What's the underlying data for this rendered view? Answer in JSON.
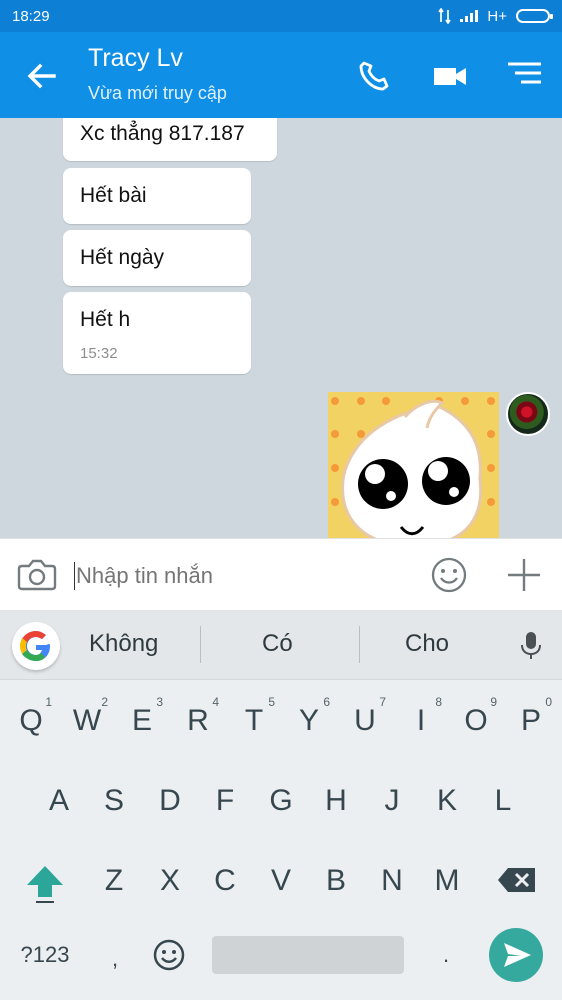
{
  "status_bar": {
    "time": "18:29",
    "network": "H+"
  },
  "chat_header": {
    "contact_name": "Tracy Lv",
    "contact_status": "Vừa mới truy cập"
  },
  "messages": [
    {
      "text": "Xc thẳng 817.187"
    },
    {
      "text": "Hết bài"
    },
    {
      "text": "Hết ngày"
    },
    {
      "text": "Hết h",
      "time": "15:32"
    }
  ],
  "composer": {
    "placeholder": "Nhập tin nhắn"
  },
  "keyboard": {
    "suggestions": [
      "Không",
      "Có",
      "Cho"
    ],
    "row1": [
      {
        "label": "Q",
        "num": "1"
      },
      {
        "label": "W",
        "num": "2"
      },
      {
        "label": "E",
        "num": "3"
      },
      {
        "label": "R",
        "num": "4"
      },
      {
        "label": "T",
        "num": "5"
      },
      {
        "label": "Y",
        "num": "6"
      },
      {
        "label": "U",
        "num": "7"
      },
      {
        "label": "I",
        "num": "8"
      },
      {
        "label": "O",
        "num": "9"
      },
      {
        "label": "P",
        "num": "0"
      }
    ],
    "row2": [
      "A",
      "S",
      "D",
      "F",
      "G",
      "H",
      "J",
      "K",
      "L"
    ],
    "row3": [
      "Z",
      "X",
      "C",
      "V",
      "B",
      "N",
      "M"
    ],
    "symbols_label": "?123",
    "comma_label": ",",
    "period_label": "."
  },
  "colors": {
    "status_bar": "#0d7fd4",
    "header": "#0f8fe5",
    "chat_background": "#ced7de",
    "send_button": "#36a99f"
  },
  "icons": [
    "back-arrow-icon",
    "phone-icon",
    "video-call-icon",
    "menu-icon",
    "camera-icon",
    "emoji-icon",
    "plus-icon",
    "google-icon",
    "microphone-icon",
    "shift-icon",
    "backspace-icon",
    "send-icon"
  ]
}
